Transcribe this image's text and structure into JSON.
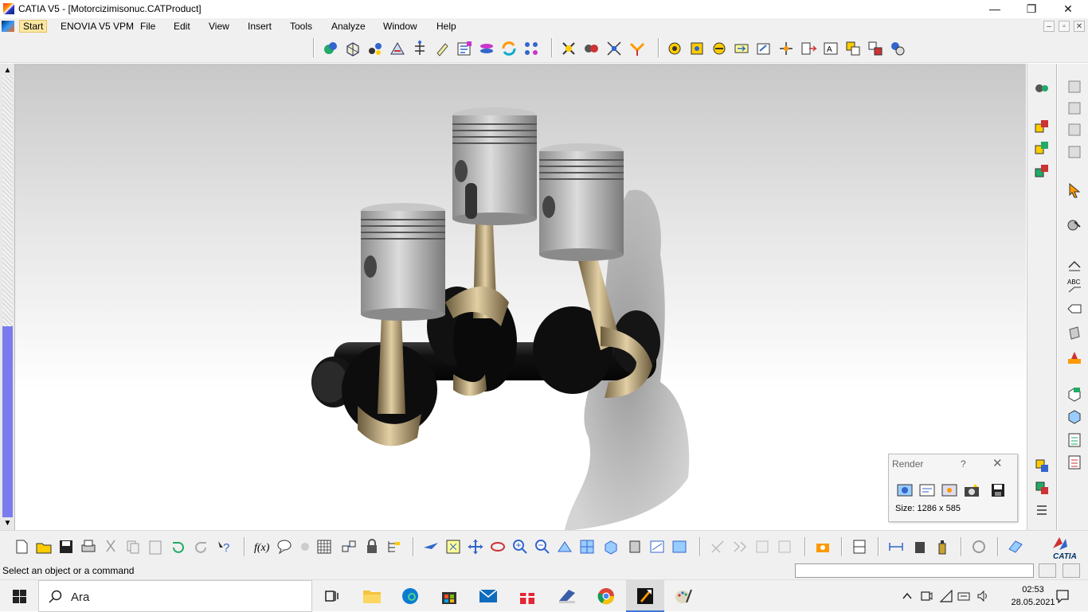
{
  "window": {
    "title": "CATIA V5 - [Motorcizimisonuc.CATProduct]",
    "minimize": "—",
    "maximize": "❐",
    "close": "✕"
  },
  "menubar": {
    "items": [
      {
        "label": "Start"
      },
      {
        "label": "ENOVIA V5 VPM"
      },
      {
        "label": "File"
      },
      {
        "label": "Edit"
      },
      {
        "label": "View"
      },
      {
        "label": "Insert"
      },
      {
        "label": "Tools"
      },
      {
        "label": "Analyze"
      },
      {
        "label": "Window"
      },
      {
        "label": "Help"
      }
    ],
    "doc_minimize": "–",
    "doc_restore": "▫",
    "doc_close": "✕"
  },
  "viewport": {
    "scroll_up": "▲",
    "scroll_down": "▼"
  },
  "render_dialog": {
    "title": "Render",
    "help": "?",
    "close": "✕",
    "size_text": "Size: 1286 x 585"
  },
  "statusbar": {
    "message": "Select an object or a command"
  },
  "taskbar": {
    "search_placeholder": "Ara",
    "time": "02:53",
    "date": "28.05.2021"
  },
  "colors": {
    "accent": "#fbe7a1",
    "scrollbar_thumb": "#7b7bef",
    "piston": "#b4b4b4",
    "crankshaft": "#1a1a1a",
    "rod": "#c2a77a"
  }
}
